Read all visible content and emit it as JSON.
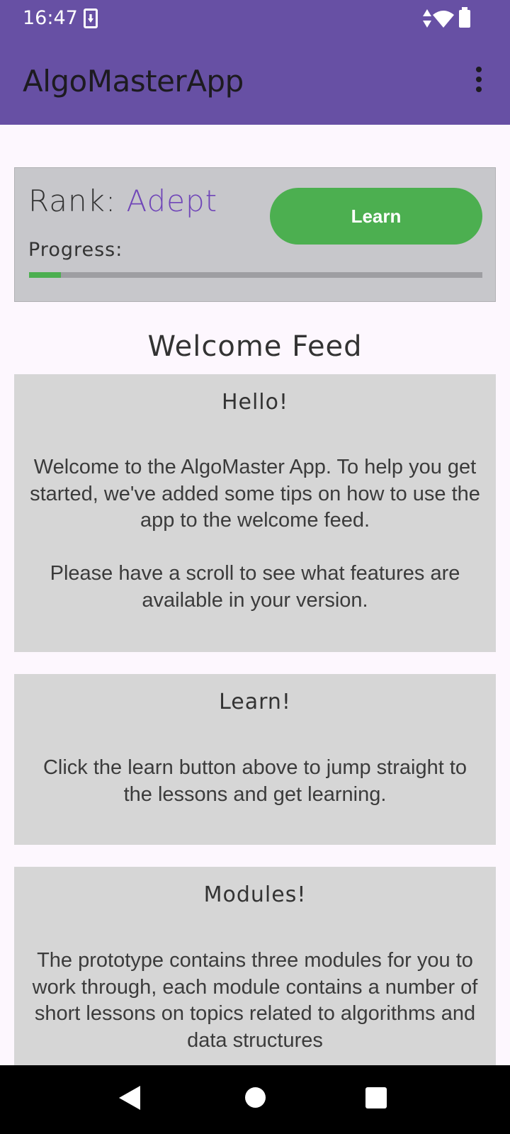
{
  "status_bar": {
    "time": "16:47",
    "icons": [
      "download-icon",
      "signal-icon",
      "wifi-icon",
      "battery-icon"
    ]
  },
  "app_bar": {
    "title": "AlgoMasterApp",
    "menu_icon": "more-vert-icon"
  },
  "rank_card": {
    "rank_label": "Rank: ",
    "rank_value": "Adept",
    "progress_label": "Progress:",
    "progress": 0.07,
    "learn_button": "Learn"
  },
  "feed": {
    "heading": "Welcome Feed",
    "cards": [
      {
        "title": "Hello!",
        "body": "Welcome to the AlgoMaster App. To help you get started, we've added some tips on how to use the app to the welcome feed.\n\nPlease have a scroll to see what features are available in your version."
      },
      {
        "title": "Learn!",
        "body": "Click the learn button above to jump straight to the lessons and get learning."
      },
      {
        "title": "Modules!",
        "body": "The prototype contains three modules for you to work through, each module contains a number of short lessons on topics related to algorithms and data structures"
      }
    ]
  },
  "colors": {
    "app_bar": "#6750a4",
    "accent_rank": "#7046b8",
    "button_green": "#4caf50",
    "card_gray": "#d6d6d6",
    "rank_card_gray": "#c7c7cb"
  }
}
